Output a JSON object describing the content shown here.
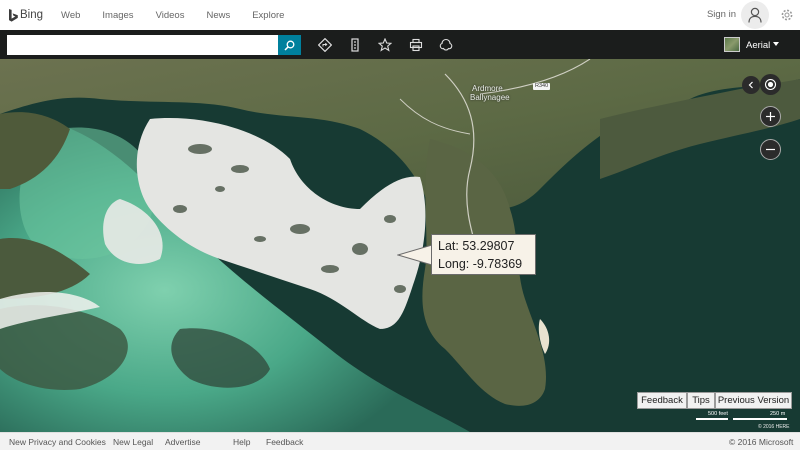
{
  "nav": {
    "brand": "Bing",
    "links": [
      "Web",
      "Images",
      "Videos",
      "News",
      "Explore"
    ],
    "signin": "Sign in"
  },
  "toolbar": {
    "search_value": "",
    "map_style": "Aerial"
  },
  "map": {
    "place_line1": "Ardmore",
    "place_line2": "Ballynagee",
    "road_shield": "R340",
    "tooltip": {
      "lat": "Lat: 53.29807",
      "long": "Long: -9.78369"
    },
    "buttons": {
      "feedback": "Feedback",
      "tips": "Tips",
      "previous_version": "Previous Version"
    },
    "scale_feet": "500 feet",
    "scale_meters": "250 m",
    "copyright_map": "© 2016 HERE"
  },
  "footer": {
    "links": [
      "New Privacy and Cookies",
      "New Legal",
      "Advertise",
      "Help",
      "Feedback"
    ],
    "copyright": "© 2016 Microsoft"
  },
  "colors": {
    "search_button": "#00809d",
    "toolbar_bg": "#1b1d1c",
    "sea_deep": "#13302a",
    "shallow_water": "#5fb896",
    "sand": "#e6e6e4"
  },
  "icons": [
    "bing-logo-icon",
    "user-avatar-icon",
    "gear-icon",
    "search-icon",
    "directions-icon",
    "traffic-icon",
    "favorites-star-icon",
    "print-icon",
    "share-icon",
    "locate-me-icon",
    "zoom-in-icon",
    "zoom-out-icon",
    "collapse-chevron-icon"
  ]
}
